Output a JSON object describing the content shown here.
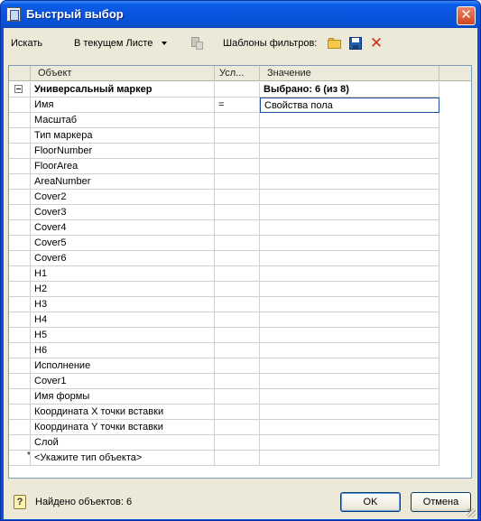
{
  "window": {
    "title": "Быстрый выбор",
    "close_glyph": "✕"
  },
  "toolbar": {
    "search_label": "Искать",
    "scope_value": "В текущем Листе",
    "filter_templates_label": "Шаблоны фильтров:",
    "delete_glyph": "✕"
  },
  "grid": {
    "columns": [
      "Объект",
      "Усл...",
      "Значение"
    ],
    "root": {
      "name": "Универсальный маркер",
      "value": "Выбрано: 6 (из 8)"
    },
    "edit_row": {
      "name": "Имя",
      "condition": "=",
      "value": "Свойства пола"
    },
    "properties": [
      "Масштаб",
      "Тип маркера",
      "FloorNumber",
      "FloorArea",
      "AreaNumber",
      "Cover2",
      "Cover3",
      "Cover4",
      "Cover5",
      "Cover6",
      "H1",
      "H2",
      "H3",
      "H4",
      "H5",
      "H6",
      "Исполнение",
      "Cover1",
      "Имя формы",
      "Координата X точки вставки",
      "Координата Y точки вставки",
      "Слой"
    ],
    "new_row": {
      "marker": "*",
      "placeholder": "<Укажите тип объекта>"
    }
  },
  "status": {
    "help_glyph": "?",
    "found_text": "Найдено объектов: 6"
  },
  "buttons": {
    "ok": "OK",
    "cancel": "Отмена"
  },
  "colors": {
    "title_bar": "#0a55dd",
    "dialog_bg": "#ece9d8",
    "delete_icon": "#d42a18"
  }
}
